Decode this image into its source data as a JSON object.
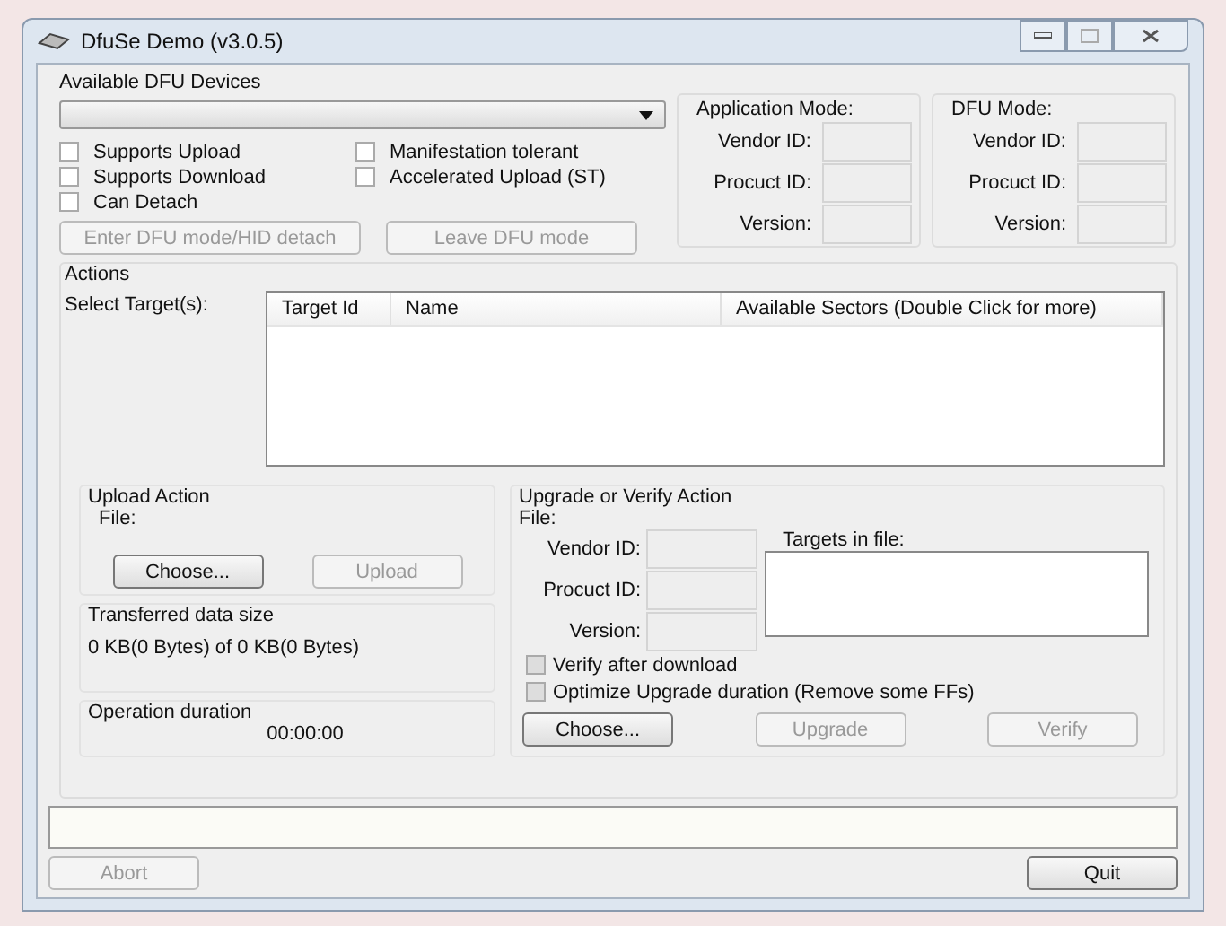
{
  "window": {
    "title": "DfuSe Demo (v3.0.5)"
  },
  "devices": {
    "label": "Available DFU Devices",
    "options": [
      {
        "label": "Supports Upload",
        "checked": false
      },
      {
        "label": "Manifestation tolerant",
        "checked": false
      },
      {
        "label": "Supports Download",
        "checked": false
      },
      {
        "label": "Accelerated Upload (ST)",
        "checked": false
      },
      {
        "label": "Can Detach",
        "checked": false
      }
    ],
    "buttons": [
      {
        "label": "Enter DFU mode/HID detach",
        "disabled": true
      },
      {
        "label": "Leave DFU mode",
        "disabled": true
      }
    ]
  },
  "modes": [
    {
      "title": "Application Mode:",
      "fields": [
        "Vendor ID:",
        "Procuct ID:",
        "Version:"
      ]
    },
    {
      "title": "DFU Mode:",
      "fields": [
        "Vendor ID:",
        "Procuct ID:",
        "Version:"
      ]
    }
  ],
  "actions": {
    "label": "Actions",
    "select_label": "Select Target(s):",
    "columns": [
      "Target Id",
      "Name",
      "Available Sectors (Double Click for more)"
    ]
  },
  "upload": {
    "title": "Upload Action",
    "file_label": "File:",
    "buttons": [
      {
        "label": "Choose...",
        "disabled": false
      },
      {
        "label": "Upload",
        "disabled": true
      }
    ],
    "transferred_label": "Transferred data size",
    "transferred_value": "0 KB(0 Bytes) of 0 KB(0 Bytes)",
    "duration_label": "Operation duration",
    "duration_value": "00:00:00"
  },
  "upgrade": {
    "title": "Upgrade or Verify Action",
    "file_label": "File:",
    "fields": [
      "Vendor ID:",
      "Procuct ID:",
      "Version:"
    ],
    "targets_label": "Targets in file:",
    "options": [
      {
        "label": "Verify after download",
        "checked": false
      },
      {
        "label": "Optimize Upgrade duration (Remove some FFs)",
        "checked": false
      }
    ],
    "buttons": [
      {
        "label": "Choose...",
        "disabled": false
      },
      {
        "label": "Upgrade",
        "disabled": true
      },
      {
        "label": "Verify",
        "disabled": true
      }
    ]
  },
  "progress": {
    "level": 0
  },
  "footer": [
    {
      "label": "Abort",
      "disabled": true
    },
    {
      "label": "Quit",
      "disabled": false
    }
  ]
}
